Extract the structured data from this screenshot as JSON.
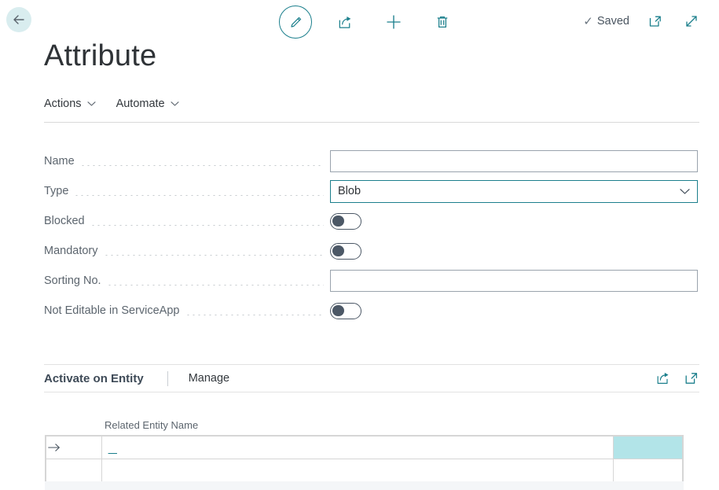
{
  "window": {
    "title": "Attribute"
  },
  "topbar": {
    "back_icon": "arrow-left-icon",
    "actions": [
      {
        "name": "edit-button",
        "icon": "pencil-icon"
      },
      {
        "name": "share-button",
        "icon": "share-icon"
      },
      {
        "name": "new-button",
        "icon": "plus-icon"
      },
      {
        "name": "delete-button",
        "icon": "trash-icon"
      }
    ],
    "status_text": "Saved",
    "status_check": "✓",
    "open_new_window_icon": "open-in-new-window-icon",
    "expand_icon": "expand-arrows-icon"
  },
  "menubar": {
    "items": [
      {
        "label": "Actions",
        "caret": "⌄"
      },
      {
        "label": "Automate",
        "caret": "⌄"
      }
    ]
  },
  "form": {
    "fields": [
      {
        "label": "Name",
        "type": "text",
        "value": "",
        "placeholder": ""
      },
      {
        "label": "Type",
        "type": "select",
        "value": "Blob",
        "focused": true
      },
      {
        "label": "Blocked",
        "type": "toggle",
        "value": "off"
      },
      {
        "label": "Mandatory",
        "type": "toggle",
        "value": "off"
      },
      {
        "label": "Sorting No.",
        "type": "text",
        "value": "",
        "placeholder": ""
      },
      {
        "label": "Not Editable in ServiceApp",
        "type": "toggle",
        "value": "off"
      }
    ]
  },
  "section": {
    "active_tab": "Activate on Entity",
    "tab": "Manage",
    "share_icon": "share-icon",
    "expand_icon": "open-in-new-window-icon"
  },
  "grid": {
    "columns": [
      "Related Entity Name"
    ],
    "rows": [
      {
        "indicator": "→",
        "related_entity_name": "_",
        "highlighted": true
      },
      {
        "indicator": "",
        "related_entity_name": "",
        "highlighted": false
      }
    ]
  },
  "colors": {
    "accent_teal": "#1b7f8c",
    "back_circle": "#d9edef",
    "highlight_cell": "#b2e4e8",
    "label_gray": "#5c656e",
    "title_gray": "#2f3337"
  }
}
